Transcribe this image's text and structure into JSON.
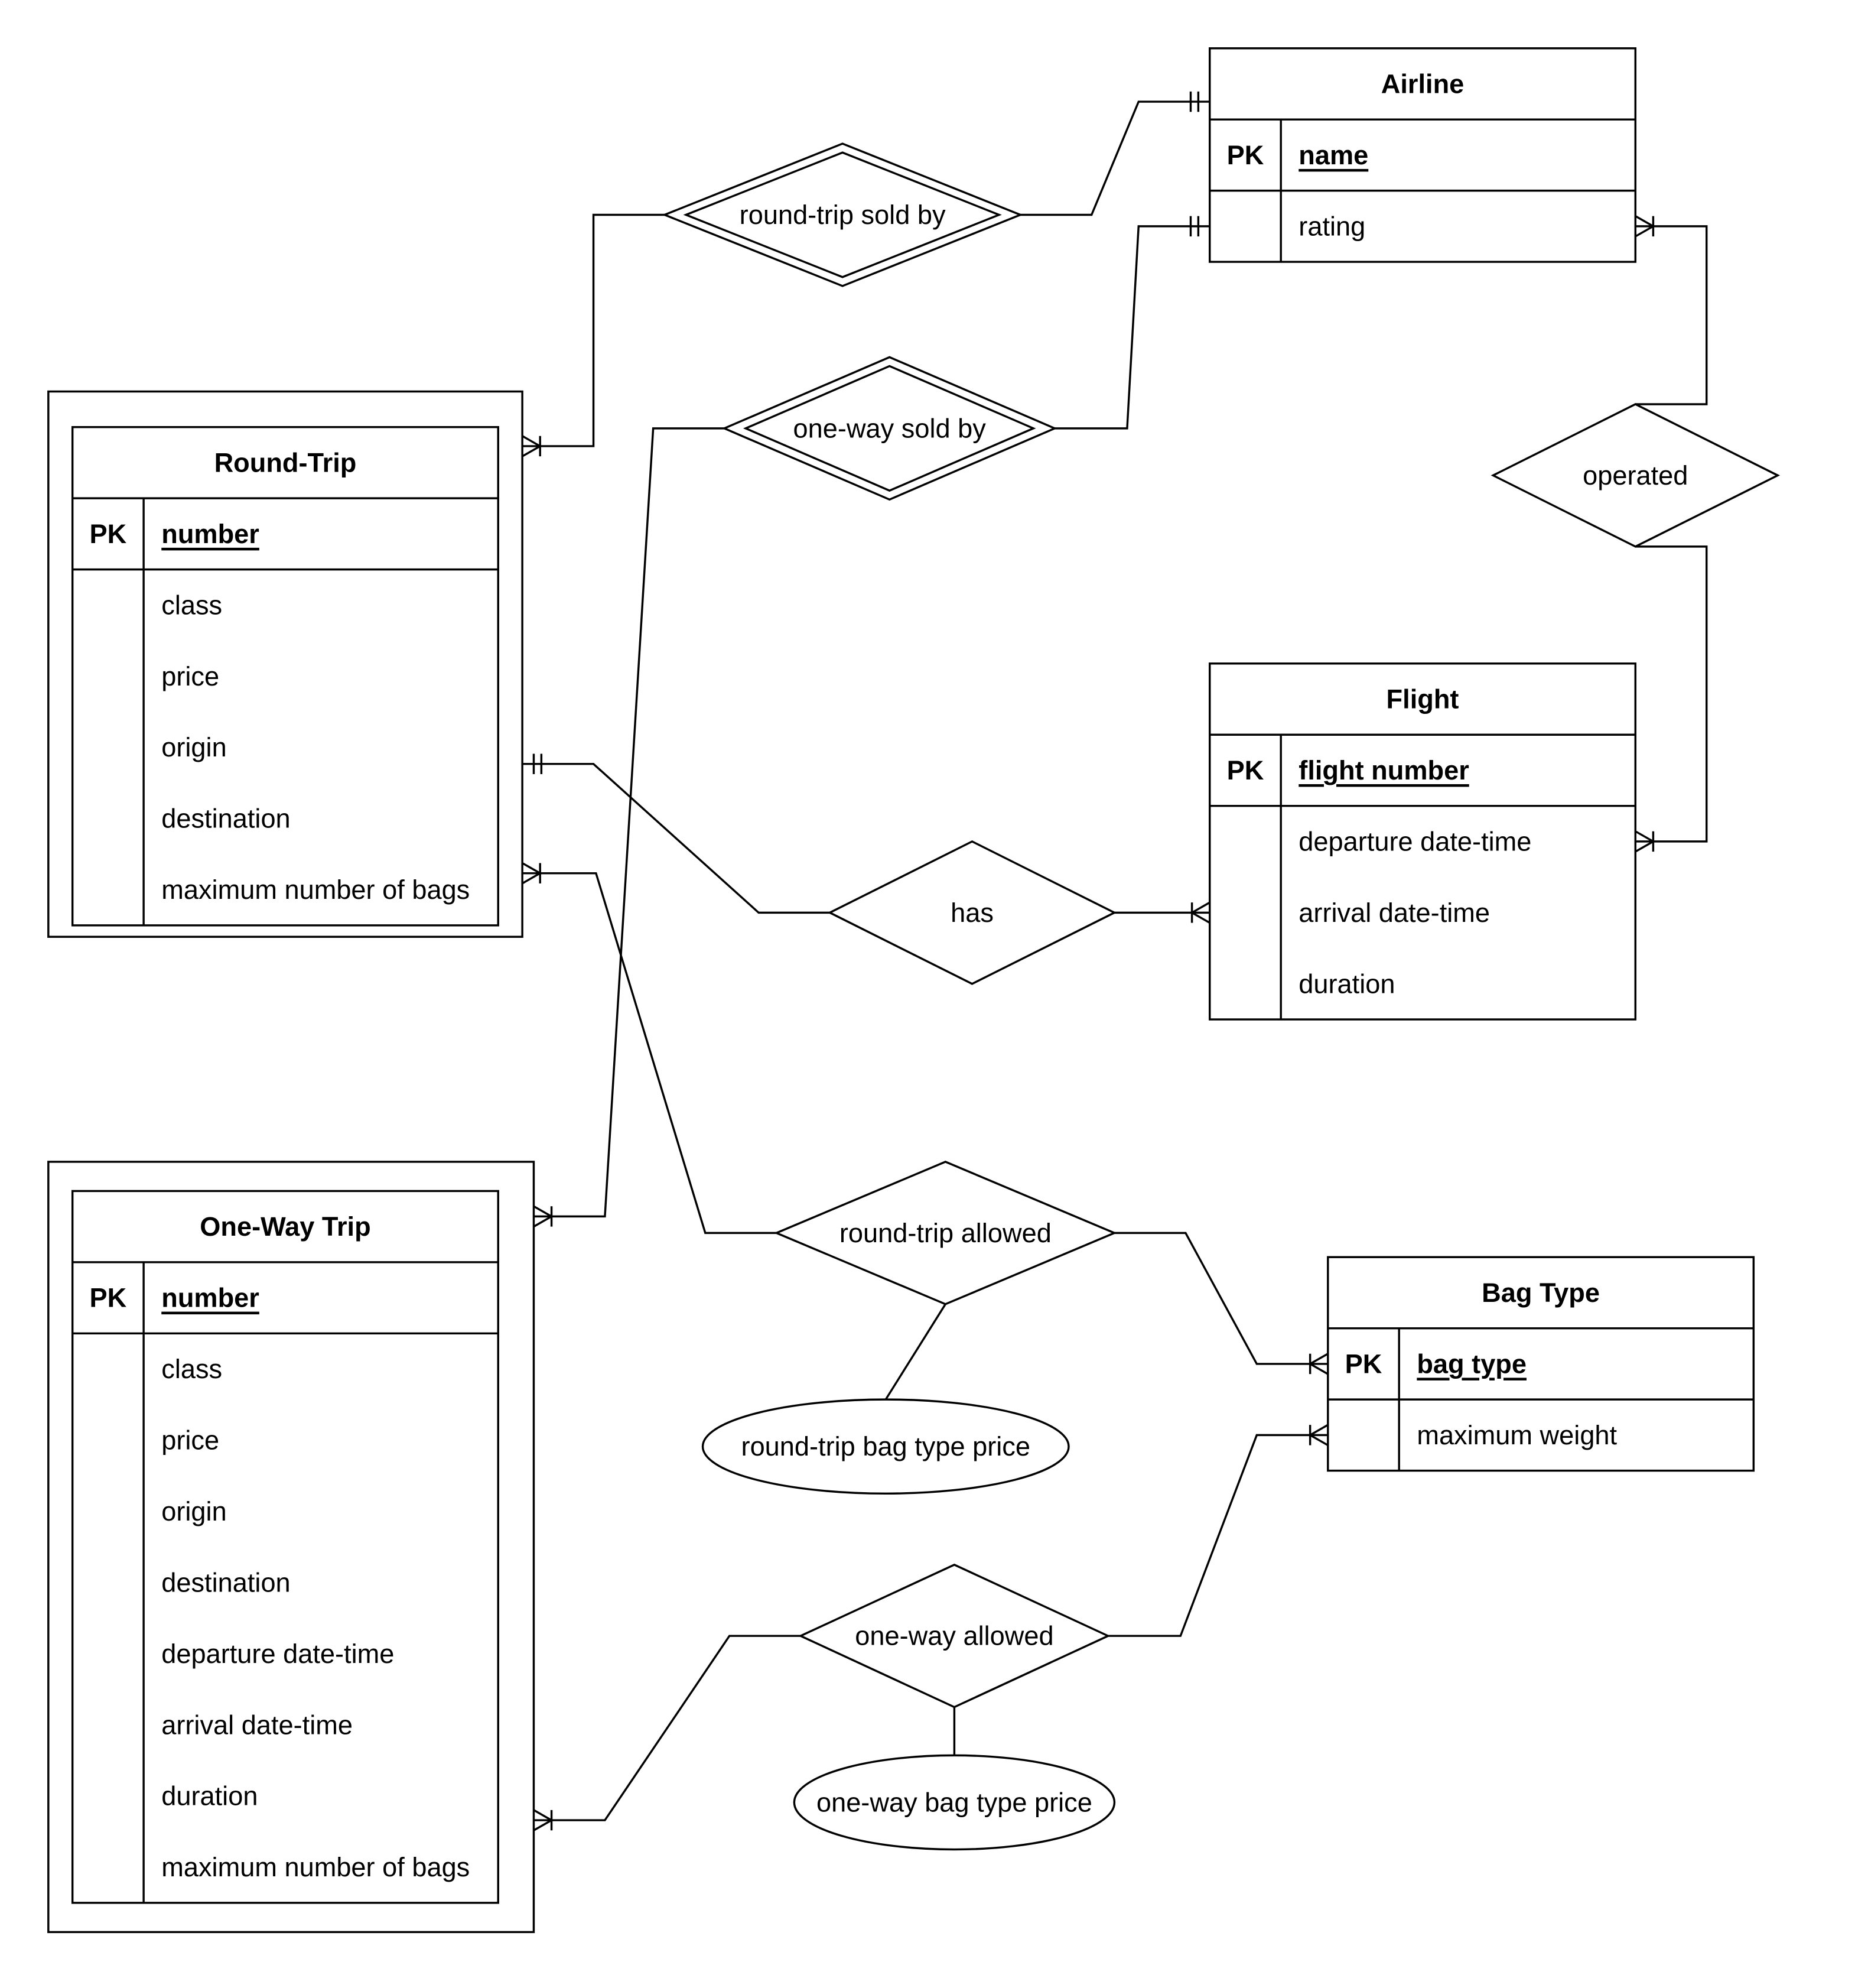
{
  "entities": {
    "airline": {
      "title": "Airline",
      "pk_label": "PK",
      "pk": "name",
      "attributes": [
        "rating"
      ]
    },
    "round_trip": {
      "title": "Round-Trip",
      "pk_label": "PK",
      "pk": "number",
      "weak": true,
      "attributes": [
        "class",
        "price",
        "origin",
        "destination",
        "maximum number of bags"
      ]
    },
    "flight": {
      "title": "Flight",
      "pk_label": "PK",
      "pk": "flight number",
      "attributes": [
        "departure date-time",
        "arrival date-time",
        "duration"
      ]
    },
    "one_way": {
      "title": "One-Way Trip",
      "pk_label": "PK",
      "pk": "number",
      "weak": true,
      "attributes": [
        "class",
        "price",
        "origin",
        "destination",
        "departure date-time",
        "arrival date-time",
        "duration",
        "maximum number of bags"
      ]
    },
    "bag_type": {
      "title": "Bag Type",
      "pk_label": "PK",
      "pk": "bag type",
      "attributes": [
        "maximum weight"
      ]
    }
  },
  "relationships": {
    "round_trip_sold_by": {
      "label": "round-trip sold by",
      "identifying": true
    },
    "one_way_sold_by": {
      "label": "one-way sold by",
      "identifying": true
    },
    "operated": {
      "label": "operated",
      "identifying": false
    },
    "has": {
      "label": "has",
      "identifying": false
    },
    "round_trip_allowed": {
      "label": "round-trip allowed",
      "identifying": false
    },
    "one_way_allowed": {
      "label": "one-way allowed",
      "identifying": false
    }
  },
  "relationship_attributes": {
    "round_trip_bag_type_price": {
      "label": "round-trip bag type price"
    },
    "one_way_bag_type_price": {
      "label": "one-way bag type price"
    }
  },
  "colors": {
    "stroke": "#000000",
    "background": "#ffffff"
  }
}
